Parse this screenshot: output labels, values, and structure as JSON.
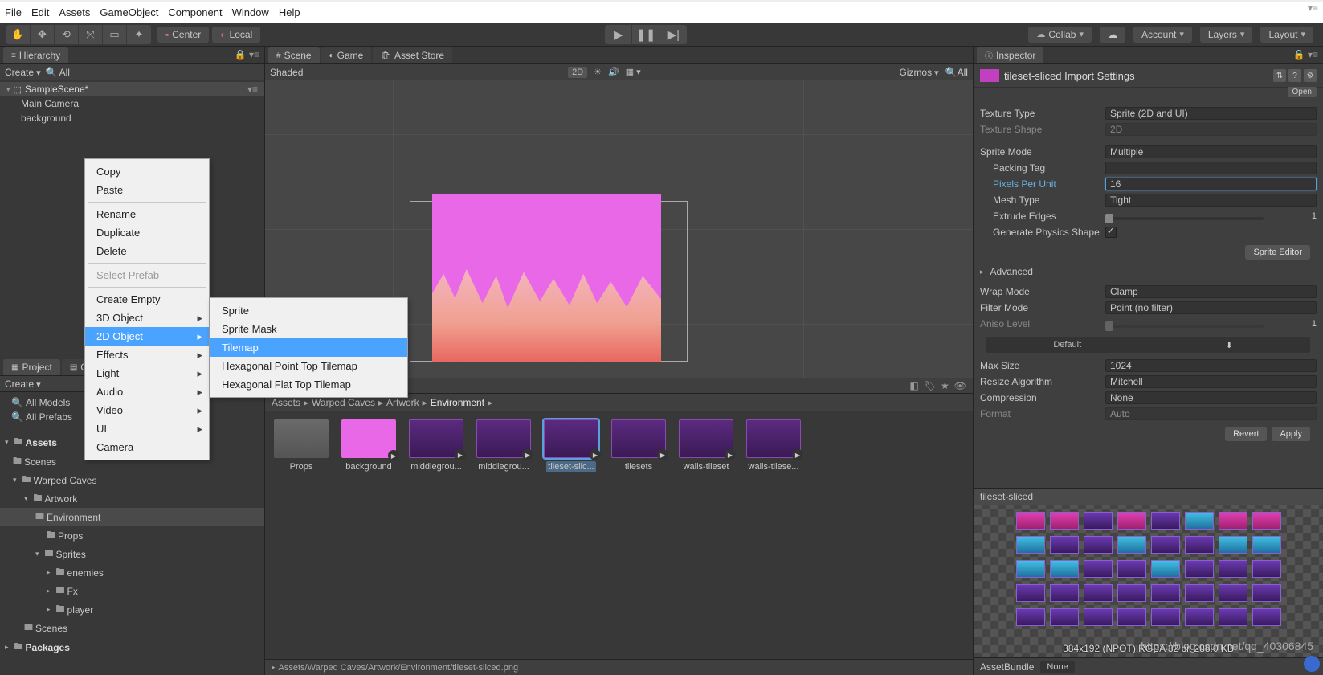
{
  "menubar": [
    "File",
    "Edit",
    "Assets",
    "GameObject",
    "Component",
    "Window",
    "Help"
  ],
  "toolbar": {
    "pivot": "Center",
    "handle": "Local",
    "collab": "Collab",
    "account": "Account",
    "layers": "Layers",
    "layout": "Layout"
  },
  "hierarchy": {
    "tab": "Hierarchy",
    "create": "Create",
    "search_placeholder": "All",
    "scene": "SampleScene*",
    "items": [
      "Main Camera",
      "background"
    ]
  },
  "context_menu_1": {
    "items": [
      "Copy",
      "Paste",
      "__sep",
      "Rename",
      "Duplicate",
      "Delete",
      "__sep",
      "Select Prefab",
      "__sep",
      "Create Empty",
      "3D Object",
      "2D Object",
      "Effects",
      "Light",
      "Audio",
      "Video",
      "UI",
      "Camera"
    ],
    "disabled": [
      "Select Prefab"
    ],
    "submenu_arrow": [
      "3D Object",
      "2D Object",
      "Effects",
      "Light",
      "Audio",
      "Video",
      "UI"
    ],
    "highlighted": "2D Object"
  },
  "context_menu_2": {
    "items": [
      "Sprite",
      "Sprite Mask",
      "Tilemap",
      "Hexagonal Point Top Tilemap",
      "Hexagonal Flat Top Tilemap"
    ],
    "highlighted": "Tilemap"
  },
  "scene_tabs": {
    "scene": "Scene",
    "game": "Game",
    "asset_store": "Asset Store"
  },
  "scene_toolbar": {
    "shading": "Shaded",
    "mode2d": "2D",
    "gizmos": "Gizmos",
    "search_placeholder": "All"
  },
  "project": {
    "tab_project": "Project",
    "tab_console": "Console",
    "create": "Create",
    "favorites": [
      "All Models",
      "All Prefabs"
    ],
    "tree": {
      "root": "Assets",
      "items": [
        {
          "l": "Scenes",
          "d": 1
        },
        {
          "l": "Warped Caves",
          "d": 1,
          "open": true
        },
        {
          "l": "Artwork",
          "d": 2,
          "open": true
        },
        {
          "l": "Environment",
          "d": 3,
          "sel": true
        },
        {
          "l": "Props",
          "d": 4
        },
        {
          "l": "Sprites",
          "d": 3,
          "open": true
        },
        {
          "l": "enemies",
          "d": 4
        },
        {
          "l": "Fx",
          "d": 4
        },
        {
          "l": "player",
          "d": 4
        },
        {
          "l": "Scenes",
          "d": 2
        }
      ],
      "packages": "Packages"
    },
    "breadcrumb": [
      "Assets",
      "Warped Caves",
      "Artwork",
      "Environment"
    ],
    "grid": [
      {
        "label": "Props",
        "type": "folder"
      },
      {
        "label": "background",
        "type": "bg1",
        "play": true
      },
      {
        "label": "middlegrou...",
        "type": "purple",
        "play": true
      },
      {
        "label": "middlegrou...",
        "type": "purple",
        "play": true
      },
      {
        "label": "tileset-slic...",
        "type": "purple",
        "play": true,
        "selected": true
      },
      {
        "label": "tilesets",
        "type": "purple",
        "play": true
      },
      {
        "label": "walls-tileset",
        "type": "purple",
        "play": true
      },
      {
        "label": "walls-tilese...",
        "type": "purple",
        "play": true
      }
    ],
    "footer_path": "Assets/Warped Caves/Artwork/Environment/tileset-sliced.png"
  },
  "inspector": {
    "tab": "Inspector",
    "title": "tileset-sliced Import Settings",
    "open_btn": "Open",
    "texture_type_label": "Texture Type",
    "texture_type": "Sprite (2D and UI)",
    "texture_shape_label": "Texture Shape",
    "texture_shape": "2D",
    "sprite_mode_label": "Sprite Mode",
    "sprite_mode": "Multiple",
    "packing_tag_label": "Packing Tag",
    "packing_tag": "",
    "pixels_per_unit_label": "Pixels Per Unit",
    "pixels_per_unit": "16",
    "mesh_type_label": "Mesh Type",
    "mesh_type": "Tight",
    "extrude_edges_label": "Extrude Edges",
    "extrude_edges": "1",
    "gen_physics_label": "Generate Physics Shape",
    "sprite_editor_btn": "Sprite Editor",
    "advanced_label": "Advanced",
    "wrap_mode_label": "Wrap Mode",
    "wrap_mode": "Clamp",
    "filter_mode_label": "Filter Mode",
    "filter_mode": "Point (no filter)",
    "aniso_label": "Aniso Level",
    "aniso": "1",
    "default_label": "Default",
    "max_size_label": "Max Size",
    "max_size": "1024",
    "resize_algo_label": "Resize Algorithm",
    "resize_algo": "Mitchell",
    "compression_label": "Compression",
    "compression": "None",
    "format_label": "Format",
    "format": "Auto",
    "revert_btn": "Revert",
    "apply_btn": "Apply",
    "preview_title": "tileset-sliced",
    "preview_caption": "384x192 (NPOT)  RGBA 32 bit  288.0 KB",
    "assetbundle_label": "AssetBundle",
    "assetbundle_value": "None"
  },
  "watermark": "https://blog.csdn.net/qq_40306845"
}
